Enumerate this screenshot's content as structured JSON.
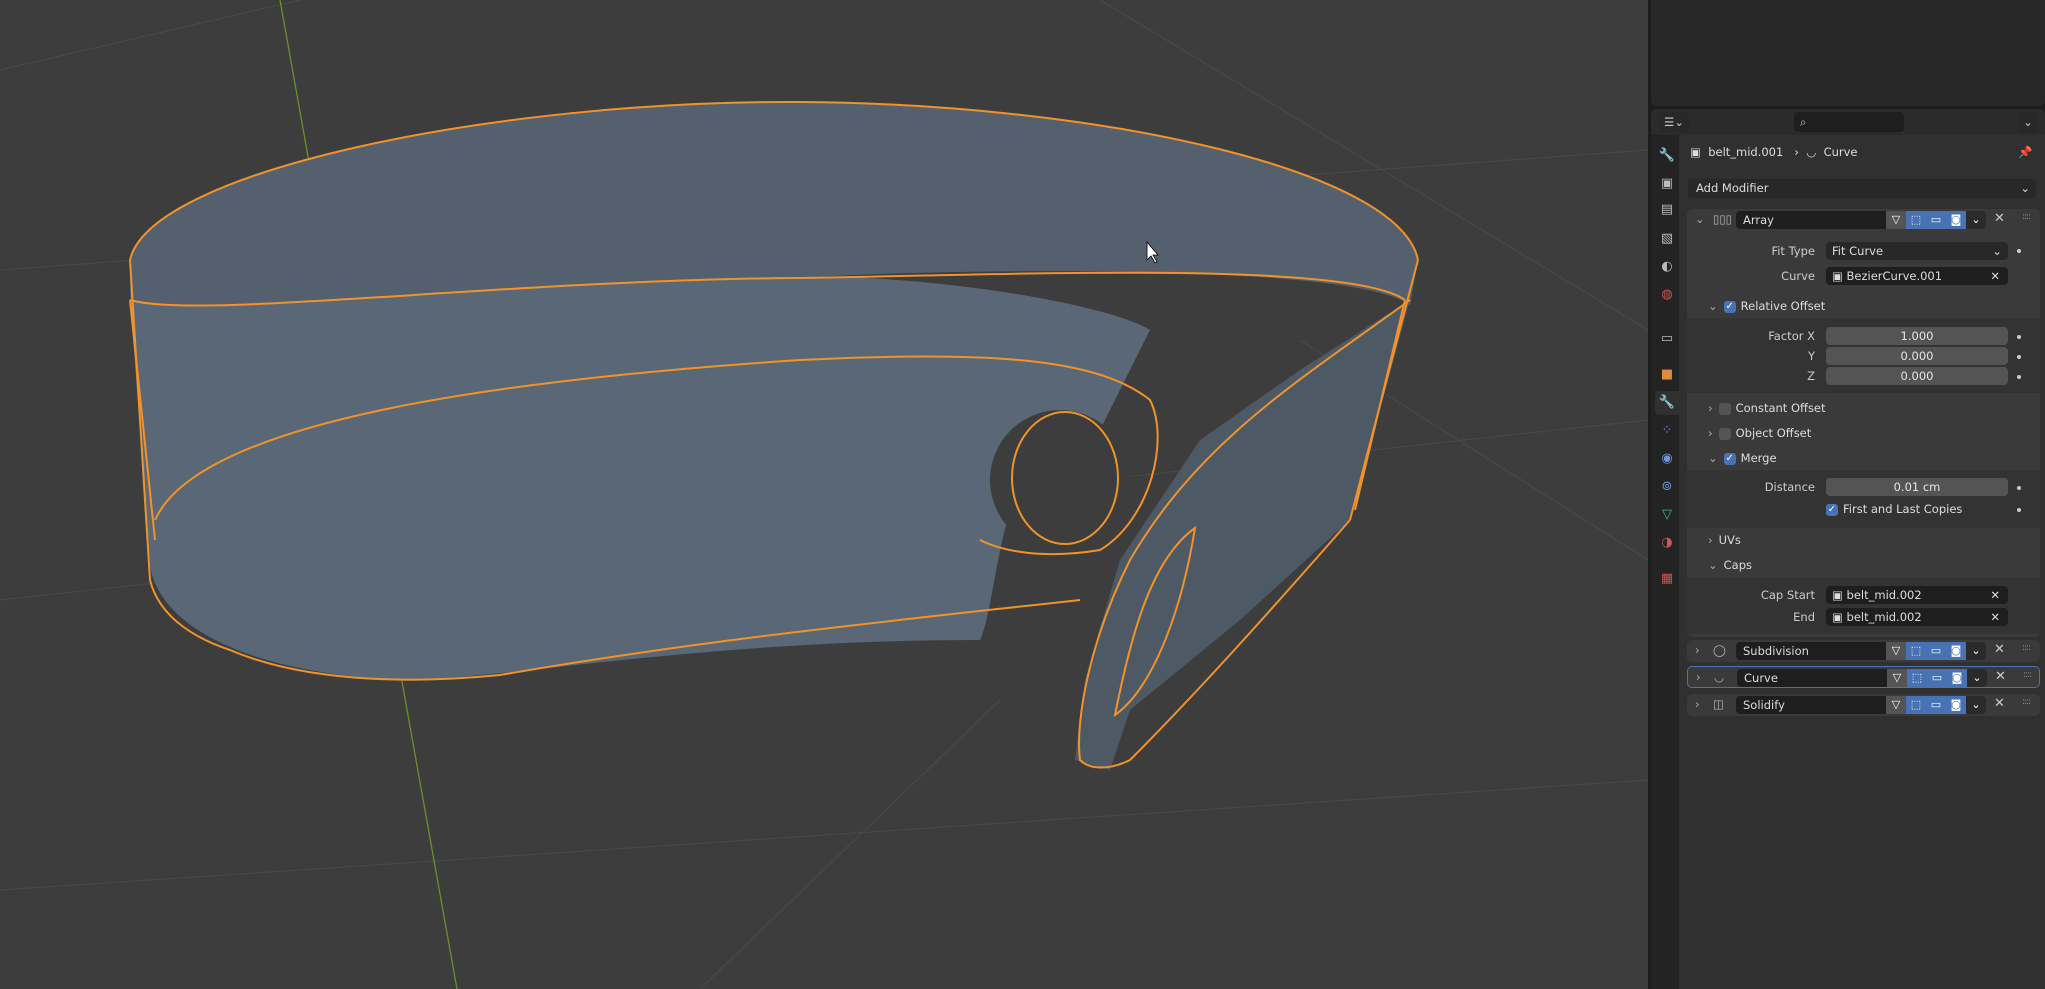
{
  "breadcrumb": {
    "object": "belt_mid.001",
    "modifier": "Curve"
  },
  "add_modifier": "Add Modifier",
  "array": {
    "name": "Array",
    "fit_type_label": "Fit Type",
    "fit_type": "Fit Curve",
    "curve_label": "Curve",
    "curve": "BezierCurve.001",
    "relative_offset": "Relative Offset",
    "factor_x_label": "Factor X",
    "factor_x": "1.000",
    "y_label": "Y",
    "y": "0.000",
    "z_label": "Z",
    "z": "0.000",
    "constant_offset": "Constant Offset",
    "object_offset": "Object Offset",
    "merge": "Merge",
    "distance_label": "Distance",
    "distance": "0.01 cm",
    "first_last": "First and Last Copies",
    "uvs": "UVs",
    "caps": "Caps",
    "cap_start_label": "Cap Start",
    "cap_start": "belt_mid.002",
    "end_label": "End",
    "end": "belt_mid.002"
  },
  "modifiers": [
    {
      "name": "Subdivision"
    },
    {
      "name": "Curve"
    },
    {
      "name": "Solidify"
    }
  ],
  "colors": {
    "accent": "#4772b3",
    "selection": "#f0932b",
    "viewport": "#3d3d3d"
  }
}
